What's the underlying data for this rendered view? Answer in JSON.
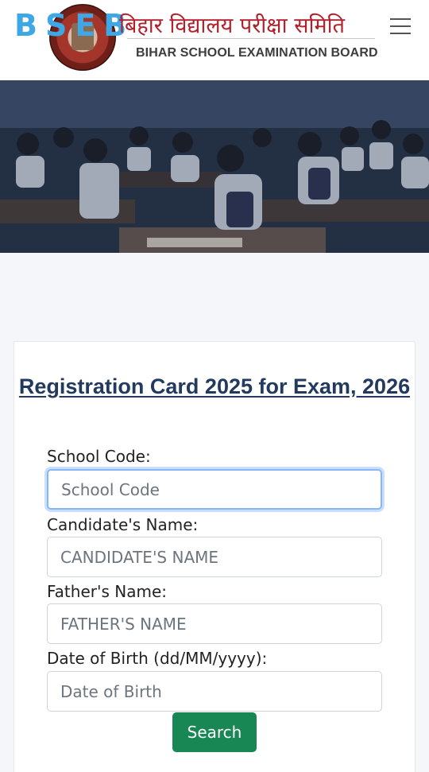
{
  "header": {
    "logo_text": "BSEB",
    "hindi_title": "बिहार विद्यालय परीक्षा समिति",
    "english_title": "BIHAR SCHOOL EXAMINATION BOARD"
  },
  "form": {
    "title": "Registration Card 2025 for Exam, 2026",
    "school_code": {
      "label": "School Code:",
      "placeholder": "School Code",
      "value": ""
    },
    "candidate_name": {
      "label": "Candidate's Name:",
      "placeholder": "CANDIDATE'S NAME",
      "value": ""
    },
    "father_name": {
      "label": "Father's Name:",
      "placeholder": "FATHER'S NAME",
      "value": ""
    },
    "dob": {
      "label": "Date of Birth (dd/MM/yyyy):",
      "placeholder": "Date of Birth",
      "value": ""
    },
    "search_label": "Search"
  },
  "colors": {
    "logo": "#3ea8e6",
    "hindi_title": "#b3202b",
    "form_title": "#223a5e",
    "search_button": "#198754",
    "focus_ring": "#86b7fe"
  },
  "icons": {
    "menu": "hamburger-menu-icon",
    "emblem": "bseb-emblem"
  }
}
